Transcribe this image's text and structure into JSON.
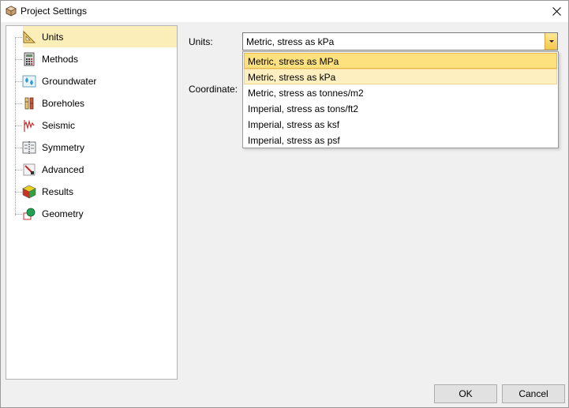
{
  "window": {
    "title": "Project Settings"
  },
  "tree": {
    "items": [
      {
        "label": "Units",
        "icon": "ruler-triangle-icon",
        "selected": true
      },
      {
        "label": "Methods",
        "icon": "calculator-icon",
        "selected": false
      },
      {
        "label": "Groundwater",
        "icon": "water-drops-icon",
        "selected": false
      },
      {
        "label": "Boreholes",
        "icon": "borehole-icon",
        "selected": false
      },
      {
        "label": "Seismic",
        "icon": "seismic-wave-icon",
        "selected": false
      },
      {
        "label": "Symmetry",
        "icon": "symmetry-icon",
        "selected": false
      },
      {
        "label": "Advanced",
        "icon": "advanced-tool-icon",
        "selected": false
      },
      {
        "label": "Results",
        "icon": "results-cube-icon",
        "selected": false
      },
      {
        "label": "Geometry",
        "icon": "geometry-icon",
        "selected": false
      }
    ]
  },
  "form": {
    "units_label": "Units:",
    "units_value": "Metric, stress as kPa",
    "coordinate_label": "Coordinate:",
    "options": [
      "Metric, stress as MPa",
      "Metric, stress as kPa",
      "Metric, stress as tonnes/m2",
      "Imperial, stress as tons/ft2",
      "Imperial, stress as ksf",
      "Imperial, stress as psf"
    ],
    "hovered_option": "Metric, stress as MPa",
    "selected_option": "Metric, stress as kPa"
  },
  "buttons": {
    "ok": "OK",
    "cancel": "Cancel"
  },
  "colors": {
    "selection": "#fceeb9",
    "hover": "#fde17f",
    "accent": "#f6c64a"
  }
}
